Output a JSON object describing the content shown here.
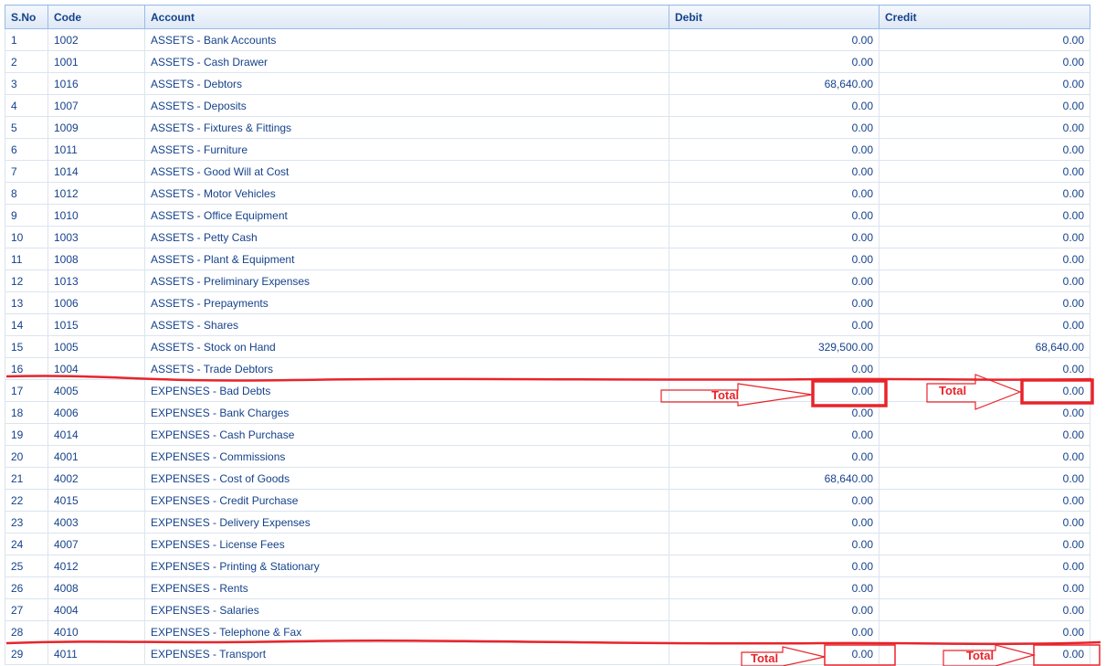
{
  "columns": {
    "sno": "S.No",
    "code": "Code",
    "account": "Account",
    "debit": "Debit",
    "credit": "Credit"
  },
  "rows": [
    {
      "sno": "1",
      "code": "1002",
      "account": "ASSETS - Bank Accounts",
      "debit": "0.00",
      "credit": "0.00"
    },
    {
      "sno": "2",
      "code": "1001",
      "account": "ASSETS - Cash Drawer",
      "debit": "0.00",
      "credit": "0.00"
    },
    {
      "sno": "3",
      "code": "1016",
      "account": "ASSETS - Debtors",
      "debit": "68,640.00",
      "credit": "0.00"
    },
    {
      "sno": "4",
      "code": "1007",
      "account": "ASSETS - Deposits",
      "debit": "0.00",
      "credit": "0.00"
    },
    {
      "sno": "5",
      "code": "1009",
      "account": "ASSETS - Fixtures & Fittings",
      "debit": "0.00",
      "credit": "0.00"
    },
    {
      "sno": "6",
      "code": "1011",
      "account": "ASSETS - Furniture",
      "debit": "0.00",
      "credit": "0.00"
    },
    {
      "sno": "7",
      "code": "1014",
      "account": "ASSETS - Good Will at Cost",
      "debit": "0.00",
      "credit": "0.00"
    },
    {
      "sno": "8",
      "code": "1012",
      "account": "ASSETS - Motor Vehicles",
      "debit": "0.00",
      "credit": "0.00"
    },
    {
      "sno": "9",
      "code": "1010",
      "account": "ASSETS - Office Equipment",
      "debit": "0.00",
      "credit": "0.00"
    },
    {
      "sno": "10",
      "code": "1003",
      "account": "ASSETS - Petty Cash",
      "debit": "0.00",
      "credit": "0.00"
    },
    {
      "sno": "11",
      "code": "1008",
      "account": "ASSETS - Plant & Equipment",
      "debit": "0.00",
      "credit": "0.00"
    },
    {
      "sno": "12",
      "code": "1013",
      "account": "ASSETS - Preliminary Expenses",
      "debit": "0.00",
      "credit": "0.00"
    },
    {
      "sno": "13",
      "code": "1006",
      "account": "ASSETS - Prepayments",
      "debit": "0.00",
      "credit": "0.00"
    },
    {
      "sno": "14",
      "code": "1015",
      "account": "ASSETS - Shares",
      "debit": "0.00",
      "credit": "0.00"
    },
    {
      "sno": "15",
      "code": "1005",
      "account": "ASSETS - Stock on Hand",
      "debit": "329,500.00",
      "credit": "68,640.00"
    },
    {
      "sno": "16",
      "code": "1004",
      "account": "ASSETS - Trade Debtors",
      "debit": "0.00",
      "credit": "0.00"
    },
    {
      "sno": "17",
      "code": "4005",
      "account": "EXPENSES - Bad Debts",
      "debit": "0.00",
      "credit": "0.00"
    },
    {
      "sno": "18",
      "code": "4006",
      "account": "EXPENSES - Bank Charges",
      "debit": "0.00",
      "credit": "0.00"
    },
    {
      "sno": "19",
      "code": "4014",
      "account": "EXPENSES - Cash Purchase",
      "debit": "0.00",
      "credit": "0.00"
    },
    {
      "sno": "20",
      "code": "4001",
      "account": "EXPENSES - Commissions",
      "debit": "0.00",
      "credit": "0.00"
    },
    {
      "sno": "21",
      "code": "4002",
      "account": "EXPENSES - Cost of Goods",
      "debit": "68,640.00",
      "credit": "0.00"
    },
    {
      "sno": "22",
      "code": "4015",
      "account": "EXPENSES - Credit Purchase",
      "debit": "0.00",
      "credit": "0.00"
    },
    {
      "sno": "23",
      "code": "4003",
      "account": "EXPENSES - Delivery Expenses",
      "debit": "0.00",
      "credit": "0.00"
    },
    {
      "sno": "24",
      "code": "4007",
      "account": "EXPENSES - License Fees",
      "debit": "0.00",
      "credit": "0.00"
    },
    {
      "sno": "25",
      "code": "4012",
      "account": "EXPENSES - Printing & Stationary",
      "debit": "0.00",
      "credit": "0.00"
    },
    {
      "sno": "26",
      "code": "4008",
      "account": "EXPENSES - Rents",
      "debit": "0.00",
      "credit": "0.00"
    },
    {
      "sno": "27",
      "code": "4004",
      "account": "EXPENSES - Salaries",
      "debit": "0.00",
      "credit": "0.00"
    },
    {
      "sno": "28",
      "code": "4010",
      "account": "EXPENSES - Telephone & Fax",
      "debit": "0.00",
      "credit": "0.00"
    },
    {
      "sno": "29",
      "code": "4011",
      "account": "EXPENSES - Transport",
      "debit": "0.00",
      "credit": "0.00"
    }
  ],
  "annotations": {
    "total_label": "Total",
    "color": "#e8242a"
  },
  "colors": {
    "text": "#15428b",
    "header_border": "#99bbe8",
    "cell_border": "#dbe4ef"
  }
}
